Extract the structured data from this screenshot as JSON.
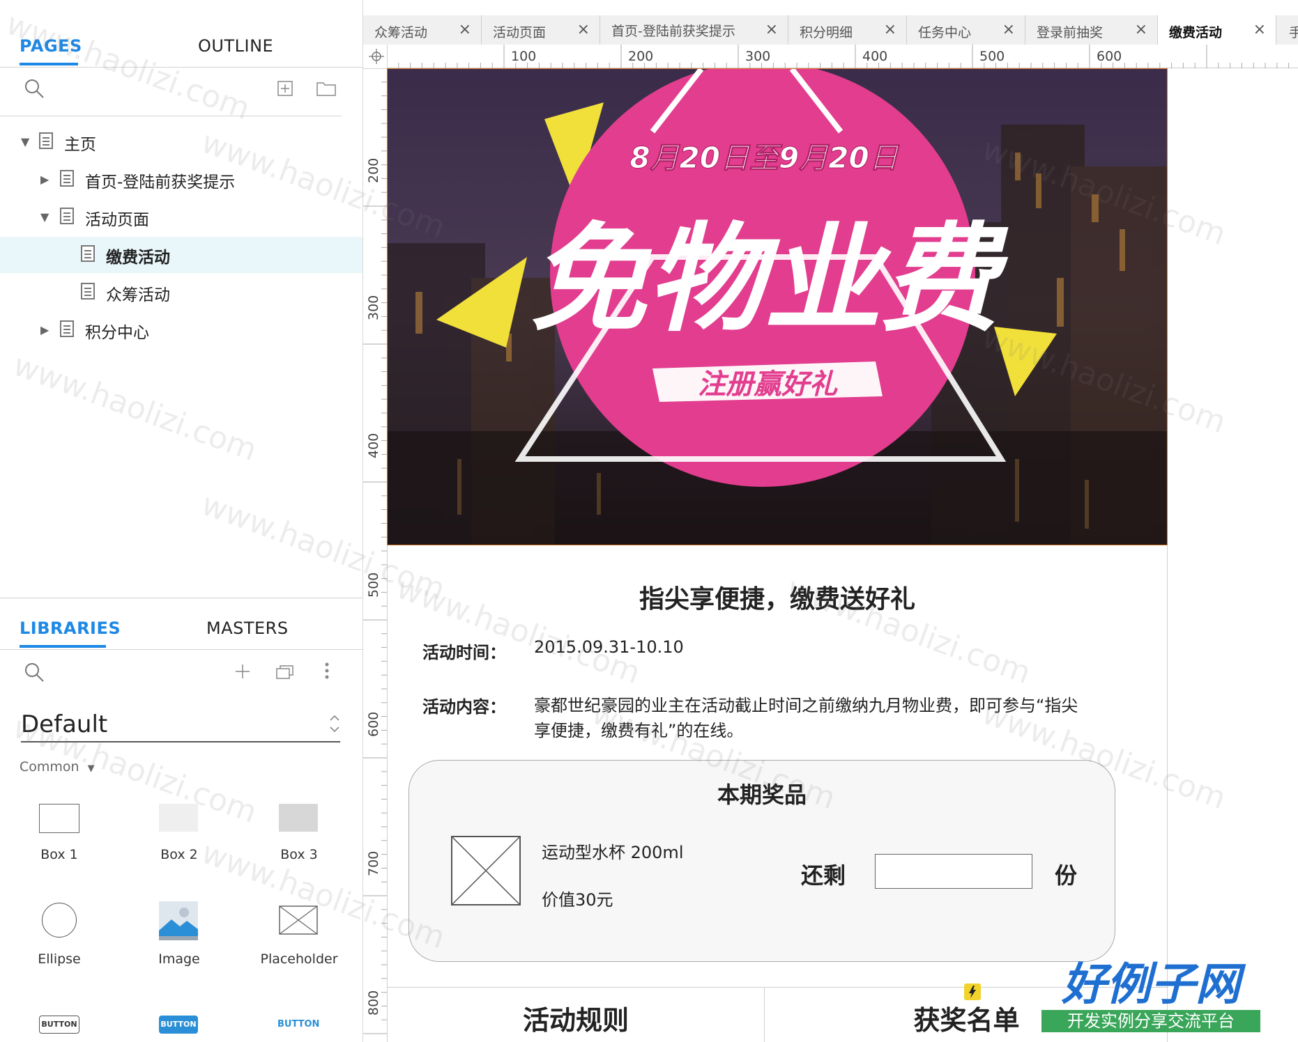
{
  "left_panel": {
    "pages_tab": "PAGES",
    "outline_tab": "OUTLINE",
    "tree": [
      {
        "label": "主页"
      },
      {
        "label": "首页-登陆前获奖提示"
      },
      {
        "label": "活动页面"
      },
      {
        "label": "缴费活动"
      },
      {
        "label": "众筹活动"
      },
      {
        "label": "积分中心"
      }
    ],
    "libraries_tab": "LIBRARIES",
    "masters_tab": "MASTERS",
    "library_select": "Default",
    "section_label": "Common",
    "section_arrow": "▼",
    "widgets": [
      {
        "label": "Box 1"
      },
      {
        "label": "Box 2"
      },
      {
        "label": "Box 3"
      },
      {
        "label": "Ellipse"
      },
      {
        "label": "Image"
      },
      {
        "label": "Placeholder"
      },
      {
        "label": "BUTTON"
      },
      {
        "label": "BUTTON"
      },
      {
        "label": "BUTTON"
      }
    ]
  },
  "doc_tabs": [
    {
      "label": "众筹活动"
    },
    {
      "label": "活动页面"
    },
    {
      "label": "首页-登陆前获奖提示"
    },
    {
      "label": "积分明细"
    },
    {
      "label": "任务中心"
    },
    {
      "label": "登录前抽奖"
    },
    {
      "label": "缴费活动"
    },
    {
      "label": "手"
    }
  ],
  "close_glyph": "×",
  "ruler": {
    "top": [
      "100",
      "200",
      "300",
      "400",
      "500",
      "600"
    ],
    "left": [
      "200",
      "300",
      "400",
      "500",
      "600",
      "700",
      "800"
    ]
  },
  "banner": {
    "date": "8月20日至9月20日",
    "headline": "免物业费",
    "subline": "注册赢好礼"
  },
  "content": {
    "title": "指尖享便捷，缴费送好礼",
    "time_label": "活动时间：",
    "time_value": "2015.09.31-10.10",
    "desc_label": "活动内容：",
    "desc_line1": "豪都世纪豪园的业主在活动截止时间之前缴纳九月物业费，即可参与“指尖",
    "desc_line2": "享便捷，缴费有礼”的在线。",
    "prize_title": "本期奖品",
    "prize_name": "运动型水杯 200ml",
    "prize_value": "价值30元",
    "remain_label": "还剩",
    "remain_unit": "份",
    "bottom_tab_rules": "活动规则",
    "bottom_tab_winners": "获奖名单"
  },
  "watermark_text": "www.haolizi.com",
  "brand": {
    "name": "好例子网",
    "slogan": "开发实例分享交流平台"
  },
  "colors": {
    "accent_blue": "#1e88e5",
    "banner_pink": "#e23d8e",
    "banner_yellow": "#f2e03a",
    "brand_blue": "#1f6fd1",
    "brand_green": "#3aa65a"
  }
}
